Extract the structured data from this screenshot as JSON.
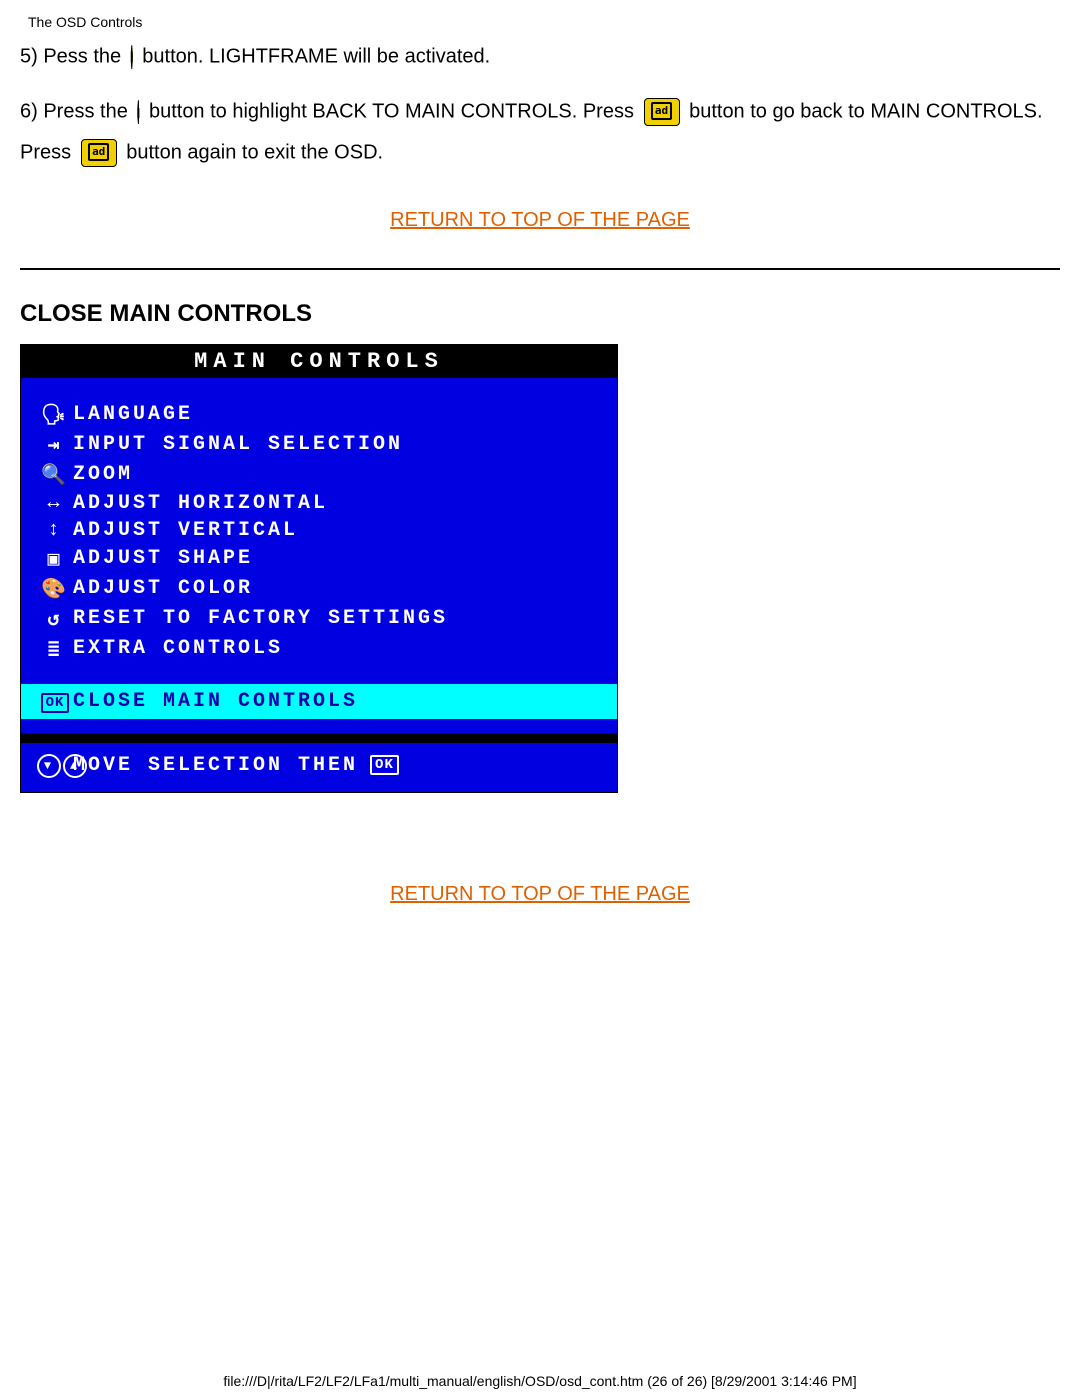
{
  "header": {
    "title": "The OSD Controls"
  },
  "steps": {
    "s5_a": "5) Pess the",
    "s5_b": "button. LIGHTFRAME will be activated.",
    "s6_a": "6) Press the",
    "s6_b": "button to highlight BACK TO MAIN CONTROLS. Press",
    "s6_c": "button to go back to MAIN CONTROLS. Press",
    "s6_d": "button again to exit the OSD."
  },
  "links": {
    "top": "RETURN TO TOP OF THE PAGE"
  },
  "section": {
    "close_h": "CLOSE MAIN CONTROLS"
  },
  "osd": {
    "title": "MAIN CONTROLS",
    "items": [
      {
        "icon": "🗣",
        "label": "LANGUAGE"
      },
      {
        "icon": "⇥",
        "label": "INPUT SIGNAL SELECTION"
      },
      {
        "icon": "🔍",
        "label": "ZOOM"
      },
      {
        "icon": "↔",
        "label": "ADJUST HORIZONTAL"
      },
      {
        "icon": "↕",
        "label": "ADJUST VERTICAL"
      },
      {
        "icon": "▣",
        "label": "ADJUST SHAPE"
      },
      {
        "icon": "🎨",
        "label": "ADJUST COLOR"
      },
      {
        "icon": "↺",
        "label": "RESET TO FACTORY SETTINGS"
      },
      {
        "icon": "≣",
        "label": "EXTRA CONTROLS"
      }
    ],
    "highlight": {
      "ok": "OK",
      "label": "CLOSE MAIN CONTROLS"
    },
    "footer": {
      "text": "MOVE SELECTION THEN",
      "ok": "OK"
    }
  },
  "footer": {
    "text": "file:///D|/rita/LF2/LF2/LFa1/multi_manual/english/OSD/osd_cont.htm (26 of 26) [8/29/2001 3:14:46 PM]"
  }
}
